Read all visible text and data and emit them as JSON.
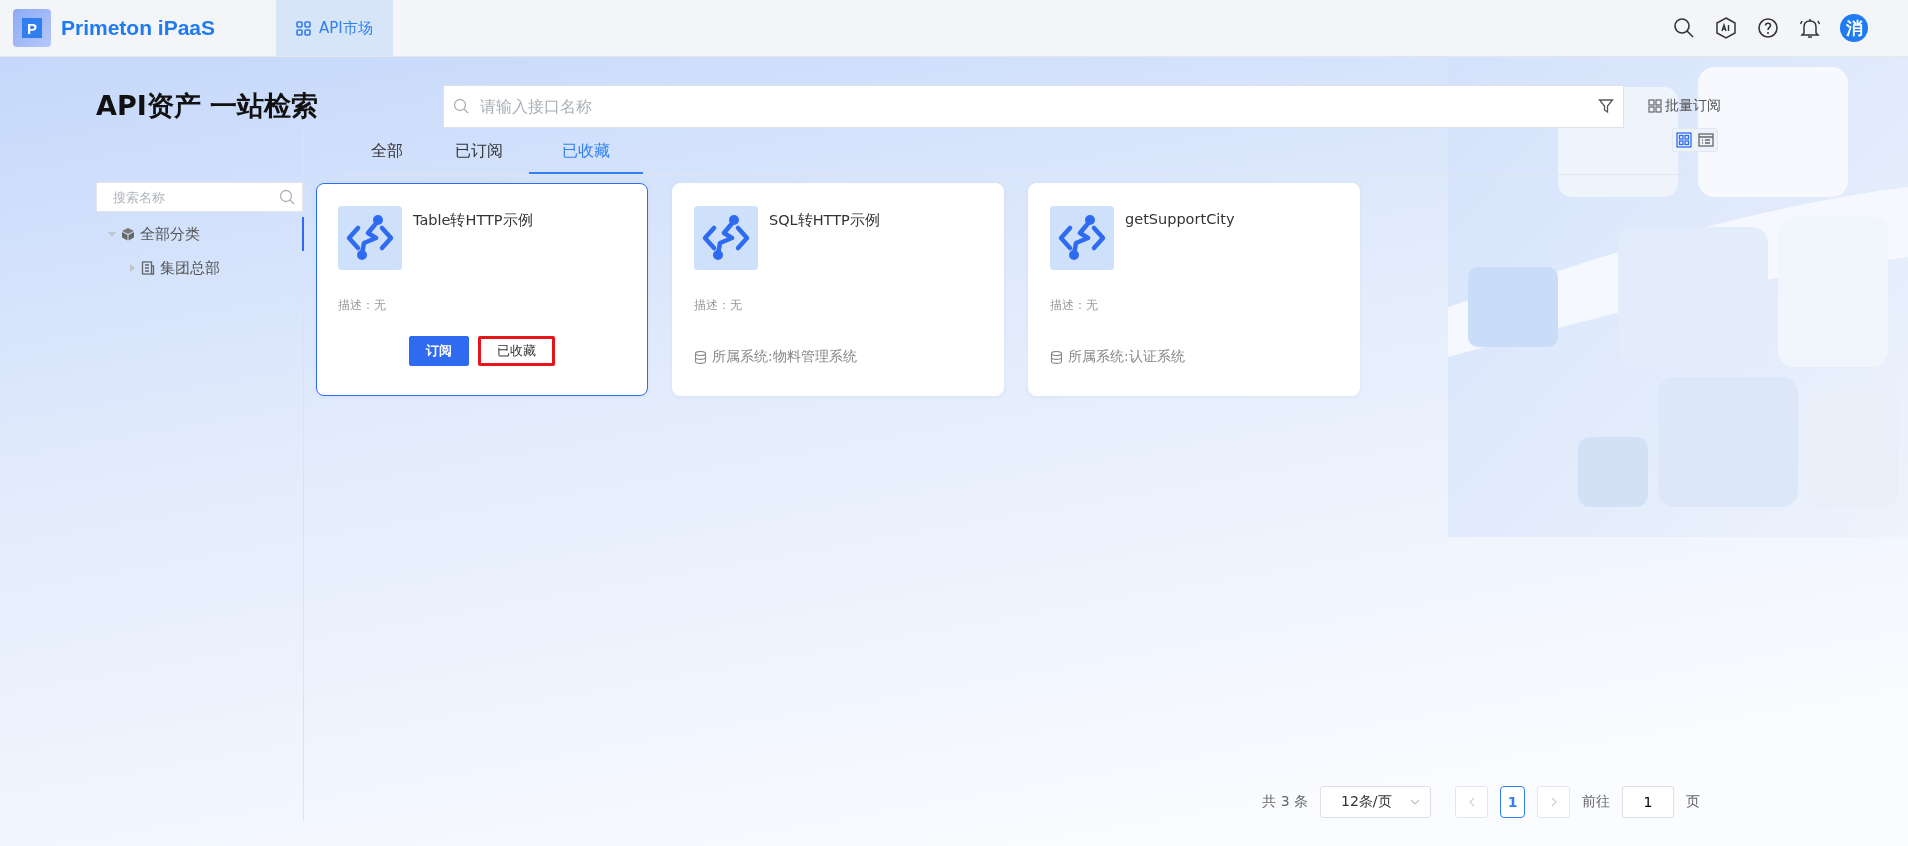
{
  "app": {
    "logo_letter": "P",
    "name": "Primeton iPaaS"
  },
  "nav_tabs": [
    {
      "label": "API市场",
      "selected": true
    }
  ],
  "user": {
    "avatar": "消"
  },
  "page_title": "API资产 一站检索",
  "search": {
    "placeholder": "请输入接口名称"
  },
  "batch_subscribe": "批量订阅",
  "view_modes": [
    {
      "kind": "grid",
      "selected": true
    },
    {
      "kind": "list",
      "selected": false
    }
  ],
  "tabs": [
    {
      "label": "全部",
      "selected": false
    },
    {
      "label": "已订阅",
      "selected": false
    },
    {
      "label": "已收藏",
      "selected": true
    }
  ],
  "sidebar": {
    "search_placeholder": "搜索名称",
    "tree": [
      {
        "label": "全部分类",
        "expanded": true,
        "selected": true,
        "children": [
          {
            "label": "集团总部",
            "expanded": false,
            "selected": false
          }
        ]
      }
    ]
  },
  "cards": [
    {
      "title": "Table转HTTP示例",
      "description": "描述：无",
      "selected": true,
      "buttons": [
        {
          "label": "订阅",
          "kind": "primary"
        },
        {
          "label": "已收藏",
          "kind": "highlighted"
        }
      ]
    },
    {
      "title": "SQL转HTTP示例",
      "description": "描述：无",
      "selected": false,
      "system": "所属系统:物料管理系统"
    },
    {
      "title": "getSupportCity",
      "description": "描述：无",
      "selected": false,
      "system": "所属系统:认证系统"
    }
  ],
  "pagination": {
    "total": "共 3 条",
    "page_size": "12条/页",
    "pages": [
      {
        "label": "1",
        "selected": true
      }
    ],
    "goto_label": "前往",
    "goto_value": "1",
    "page_suffix": "页"
  }
}
